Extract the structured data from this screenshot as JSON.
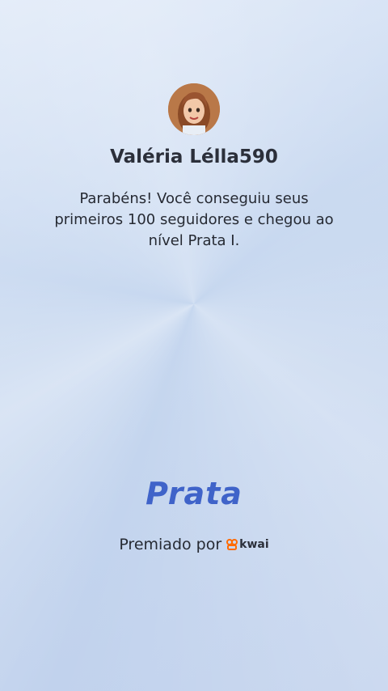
{
  "profile": {
    "username": "Valéria Lélla590",
    "avatar_icon": "avatar-icon"
  },
  "message": "Parabéns! Você conseguiu seus primeiros 100 seguidores e chegou ao nível Prata I.",
  "tier": {
    "name": "Prata",
    "color": "#3f63c9"
  },
  "award": {
    "label": "Premiado por",
    "brand": "kwai",
    "brand_icon": "kwai-logo-icon",
    "brand_color": "#ff6a00"
  }
}
